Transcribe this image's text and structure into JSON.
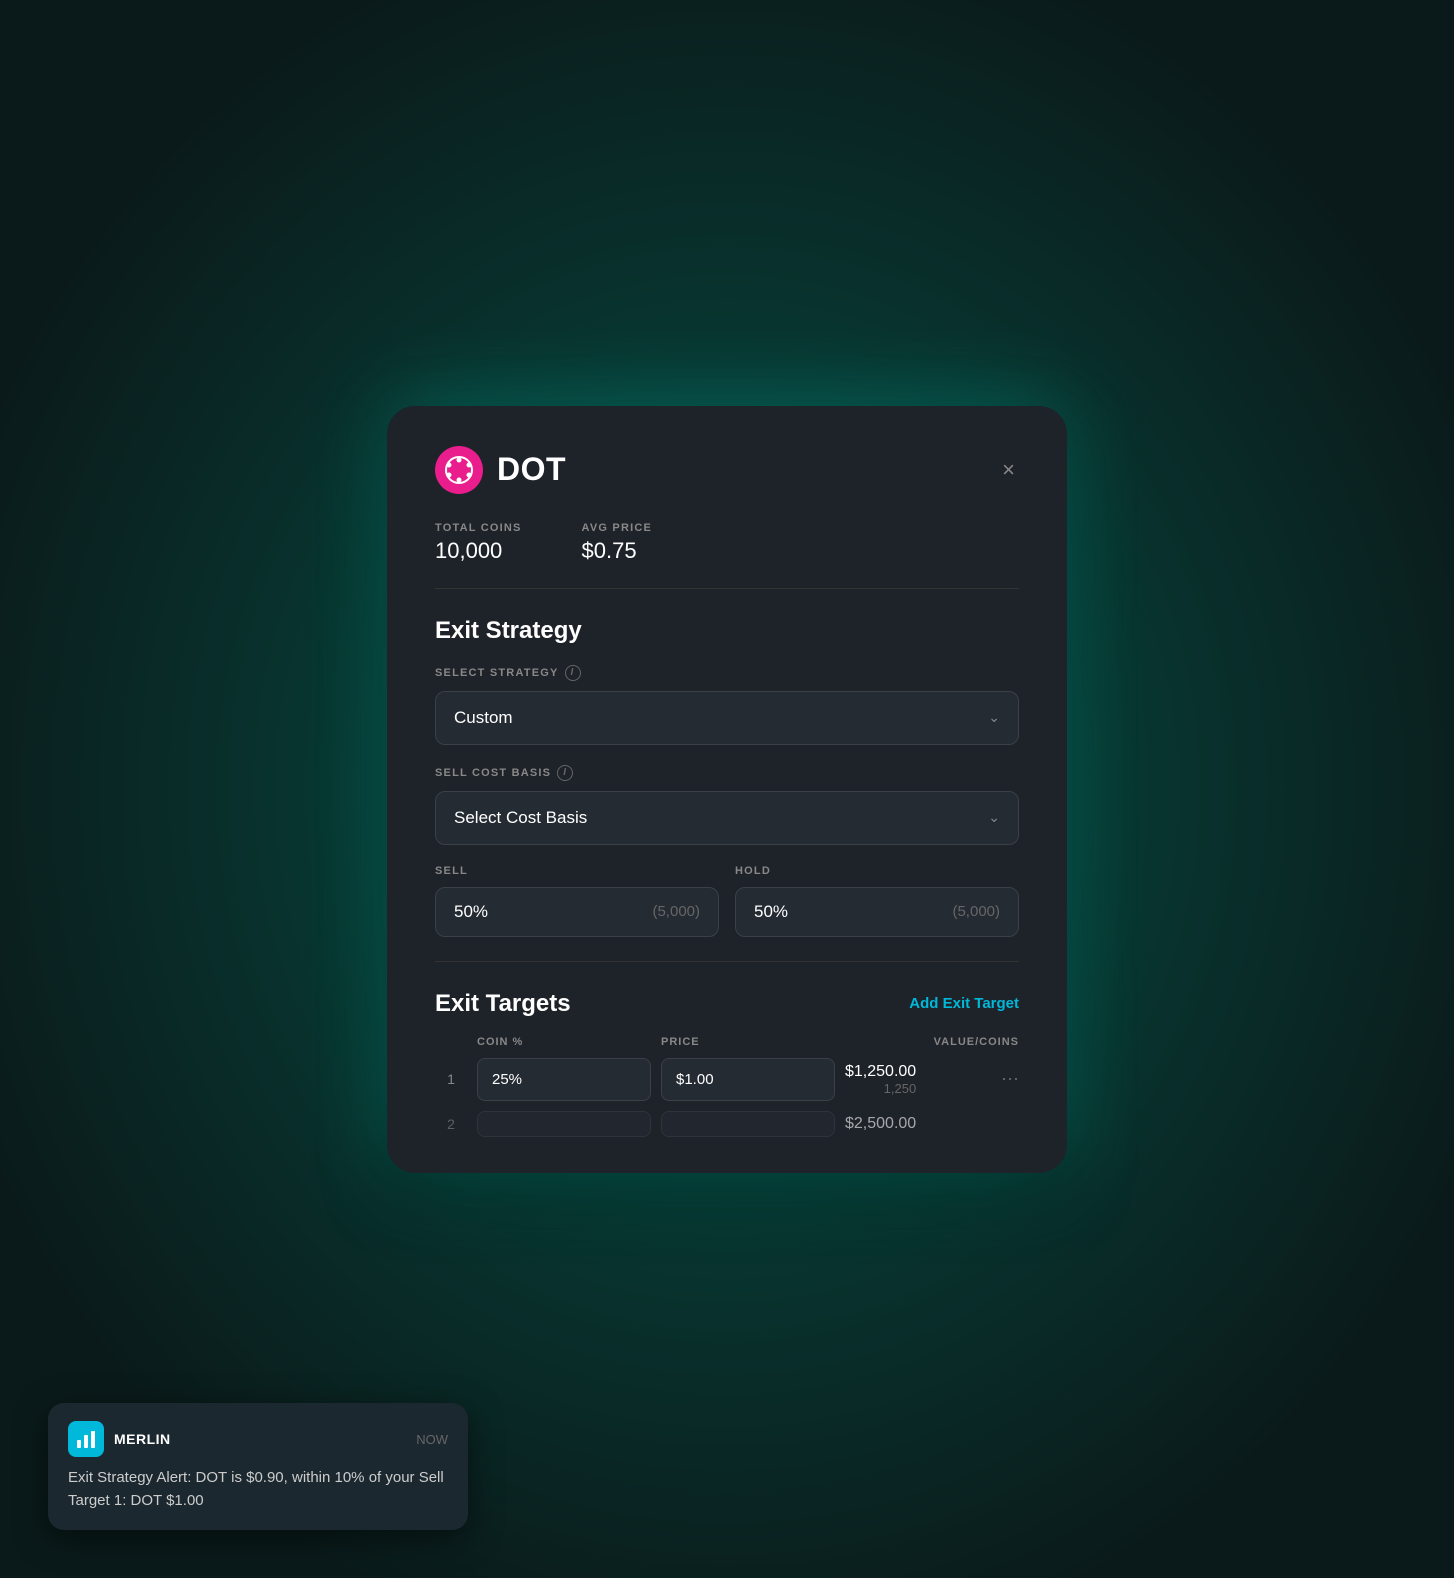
{
  "background": {
    "glow_color": "#00e5cc"
  },
  "modal": {
    "coin": {
      "name": "DOT",
      "icon_color": "#e91e8c"
    },
    "close_label": "×",
    "stats": {
      "total_coins_label": "TOTAL COINS",
      "total_coins_value": "10,000",
      "avg_price_label": "AVG PRICE",
      "avg_price_value": "$0.75"
    },
    "exit_strategy": {
      "section_title": "Exit Strategy",
      "strategy_label": "SELECT STRATEGY",
      "strategy_value": "Custom",
      "cost_basis_label": "SELL COST BASIS",
      "cost_basis_value": "Select Cost Basis",
      "sell_label": "SELL",
      "sell_percent": "50%",
      "sell_coins": "(5,000)",
      "hold_label": "HOLD",
      "hold_percent": "50%",
      "hold_coins": "(5,000)"
    },
    "exit_targets": {
      "section_title": "Exit Targets",
      "add_button_label": "Add Exit Target",
      "col_coin_pct": "COIN %",
      "col_price": "PRICE",
      "col_value_coins": "VALUE/COINS",
      "rows": [
        {
          "num": "1",
          "coin_pct": "25%",
          "price": "$1.00",
          "value": "$1,250.00",
          "coins": "1,250"
        },
        {
          "num": "2",
          "coin_pct": "",
          "price": "",
          "value": "$2,500.00",
          "coins": ""
        }
      ]
    }
  },
  "toast": {
    "app_name": "MERLIN",
    "time": "NOW",
    "message": "Exit Strategy Alert: DOT is $0.90, within 10% of your Sell Target 1: DOT $1.00"
  }
}
